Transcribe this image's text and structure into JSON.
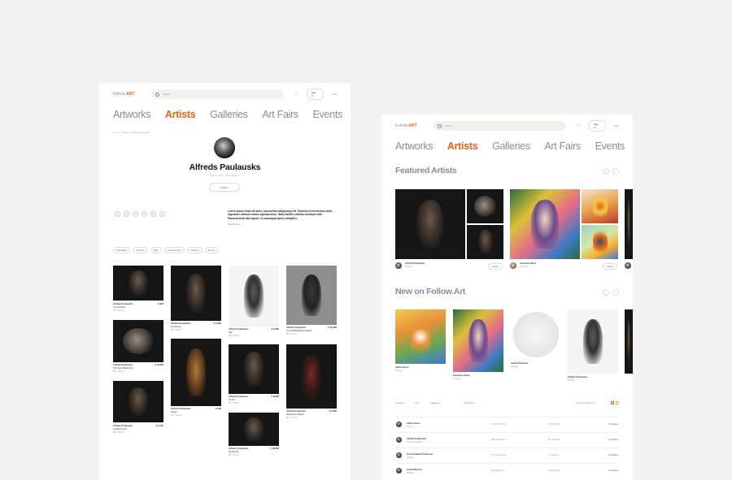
{
  "brand": {
    "prefix": "Follow.",
    "suffix": "ART"
  },
  "search_placeholder": "Search",
  "header": {
    "signin": "Sign in",
    "lang": "LNG"
  },
  "nav": [
    "Artworks",
    "Artists",
    "Galleries",
    "Art Fairs",
    "Events"
  ],
  "nav_active": "Artists",
  "artist_page": {
    "breadcrumb": "Home  ›  Artists  ›  Alfreds Paulausks",
    "name": "Alfreds Paulausks",
    "meta": "Latvia, 1976   ·   96 Followers",
    "follow": "Follow",
    "social": [
      "◎",
      "◎",
      "◎",
      "◎",
      "◎",
      "◎"
    ],
    "bio": "Lorem ipsum dolor sit amet, consectetur adipiscing elit. Vivamus ut fermentum dolor dignissim ultricies ornare egestas dolor. Nulla facilisi, lobortis tincidunt nibh. Placerat iacta nibh ipsum, et consequat lacus volutpat a.",
    "read_more": "Read More ›",
    "tags": [
      "Surrealism",
      "Abstract",
      "Male",
      "Contemporary",
      "Painting",
      "Bronze"
    ],
    "artworks": [
      {
        "artist": "Alfreds Paulausks",
        "title": "Composition",
        "size": "80 × 80 cm",
        "price": "$ 395"
      },
      {
        "artist": "Alfreds Paulausks",
        "title": "The New Beginning",
        "size": "80 × 80 cm",
        "price": "€ 16,850"
      },
      {
        "artist": "Alfreds Paulausks",
        "title": "Awakening III",
        "size": "80 × 80 cm",
        "price": "€ 3,200"
      },
      {
        "artist": "Alfreds Paulausks",
        "title": "Synthesis",
        "size": "80 × 80 cm",
        "price": "€ 1,890"
      },
      {
        "artist": "Alfreds Paulausks",
        "title": "Origin",
        "size": "80 × 80 cm",
        "price": "$ 295"
      },
      {
        "artist": "Alfreds Paulausks",
        "title": "Silk",
        "size": "80 × 80 cm",
        "price": "€ 6,850"
      },
      {
        "artist": "Alfreds Paulausks",
        "title": "Touch",
        "size": "80 × 80 cm",
        "price": "€ 8,800"
      },
      {
        "artist": "Alfreds Paulausks",
        "title": "Synthesis",
        "size": "80 × 80 cm",
        "price": "€ 16,850"
      },
      {
        "artist": "Alfreds Paulausks",
        "title": "Journal Brandnew Edition",
        "size": "80 × 80 cm",
        "price": "€ 35,300"
      },
      {
        "artist": "Alfreds Paulausks",
        "title": "Departure Station",
        "size": "80 × 80 cm",
        "price": "€ 2,950"
      }
    ]
  },
  "artists_page": {
    "featured_title": "Featured Artists",
    "featured": [
      {
        "name": "Alfreds Paulausks",
        "role": "Painter",
        "follow": "Follow"
      },
      {
        "name": "Carolina Alvisa",
        "role": "Sculptor",
        "follow": "Follow"
      }
    ],
    "new_title": "New on Follow.Art",
    "new_artists": [
      {
        "name": "Albinn Rous",
        "role": "Painter"
      },
      {
        "name": "Carolina Alvisa",
        "role": "Sculptor"
      },
      {
        "name": "Carlie Palomino",
        "role": "Painter"
      },
      {
        "name": "Alfreds Paulausks",
        "role": "Painter"
      }
    ],
    "filters": [
      "Country ⌄",
      "City ⌄",
      "Category ⌄",
      "All Artists ⌄",
      "Sort by name A-Z ⌄"
    ],
    "list": [
      {
        "name": "Albinn Rous",
        "loc": "Latvia",
        "followers": "1,6k Followers",
        "artworks": "56 artworks",
        "link": "Artworks ›"
      },
      {
        "name": "Alfreds Paulausks",
        "loc": "United Kingdom",
        "followers": "96k Followers",
        "artworks": "36 artworks",
        "link": "Artworks ›"
      },
      {
        "name": "Gary Elizabeth Peterson",
        "loc": "Russia",
        "followers": "5,4 k Followers",
        "artworks": "7 artworks",
        "link": "Artworks ›"
      },
      {
        "name": "Carlie Mercier",
        "loc": "Ukraine",
        "followers": "96 Followers",
        "artworks": "22 artworks",
        "link": "Artworks ›"
      }
    ]
  },
  "colors": {
    "accent": "#e8650f",
    "nav_inactive": "#8c8c8c",
    "background": "#f2f2f2"
  }
}
